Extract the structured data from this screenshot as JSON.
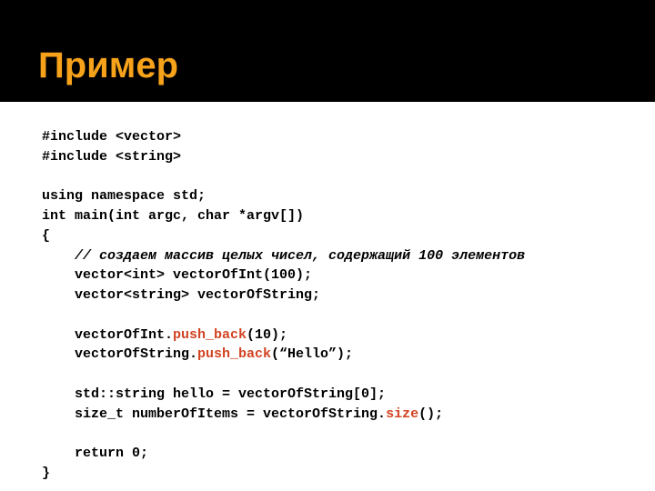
{
  "title": "Пример",
  "code": {
    "l1a": "#include ",
    "l1b": "<vector>",
    "l2a": "#include ",
    "l2b": "<string>",
    "l3": "",
    "l4": "using namespace std;",
    "l5": "int main(int argc, char *argv[])",
    "l6": "{",
    "l7": "    // создаем массив целых чисел, содержащий 100 элементов",
    "l8a": "    vector",
    "l8b": "<int>",
    "l8c": " vectorOfInt(100);",
    "l9a": "    vector",
    "l9b": "<string>",
    "l9c": " vectorOfString;",
    "l10": "",
    "l11a": "    vectorOfInt.",
    "l11b": "push_back",
    "l11c": "(10);",
    "l12a": "    vectorOfString.",
    "l12b": "push_back",
    "l12c": "(“Hello”);",
    "l13": "",
    "l14": "    std::string hello = vectorOfString[0];",
    "l15a": "    size_t numberOfItems = vectorOfString.",
    "l15b": "size",
    "l15c": "();",
    "l16": "",
    "l17": "    return 0;",
    "l18": "}"
  }
}
